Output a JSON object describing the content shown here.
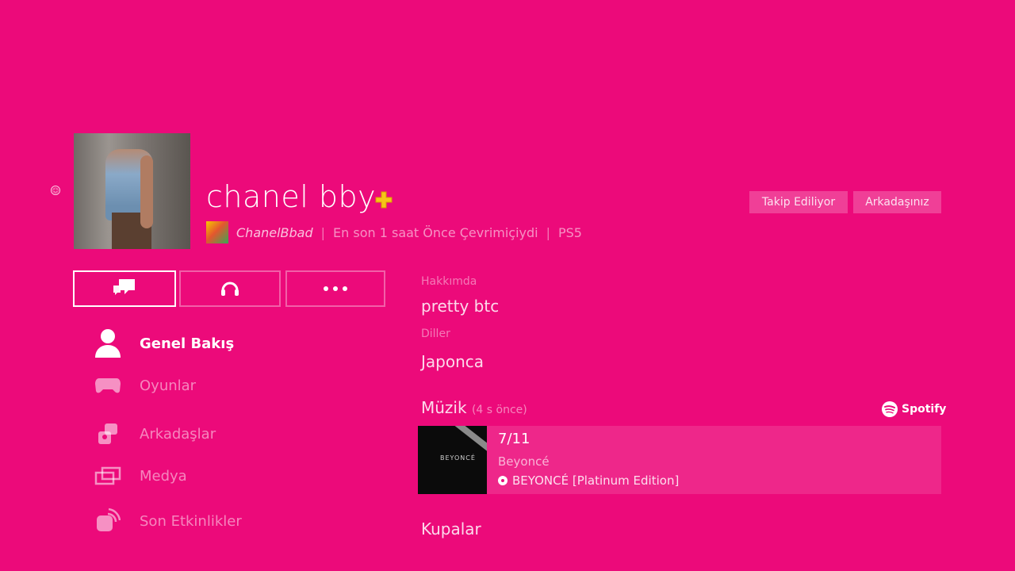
{
  "profile": {
    "username": "chanel bby",
    "online_id": "ChanelBbad",
    "last_online": "En son 1 saat Önce Çevrimiçiydi",
    "platform": "PS5",
    "follow_button": "Takip Ediliyor",
    "friend_button": "Arkadaşınız"
  },
  "colors": {
    "background": "#EC0A7A",
    "plus_gold": "#F5C518"
  },
  "actions": [
    {
      "name": "message-button",
      "icon": "message-icon"
    },
    {
      "name": "party-button",
      "icon": "headset-icon"
    },
    {
      "name": "more-button",
      "icon": "ellipsis-icon"
    }
  ],
  "nav": {
    "overview": "Genel Bakış",
    "games": "Oyunlar",
    "friends": "Arkadaşlar",
    "media": "Medya",
    "activities": "Son Etkinlikler"
  },
  "about": {
    "label": "Hakkımda",
    "value": "pretty btc",
    "lang_label": "Diller",
    "lang_value": "Japonca"
  },
  "music": {
    "title": "Müzik",
    "ago": "(4 s önce)",
    "provider": "Spotify",
    "track": "7/11",
    "artist": "Beyoncé",
    "album": "BEYONCÉ [Platinum Edition]",
    "album_art_text": "BEYONCÉ"
  },
  "trophies": {
    "title": "Kupalar"
  }
}
